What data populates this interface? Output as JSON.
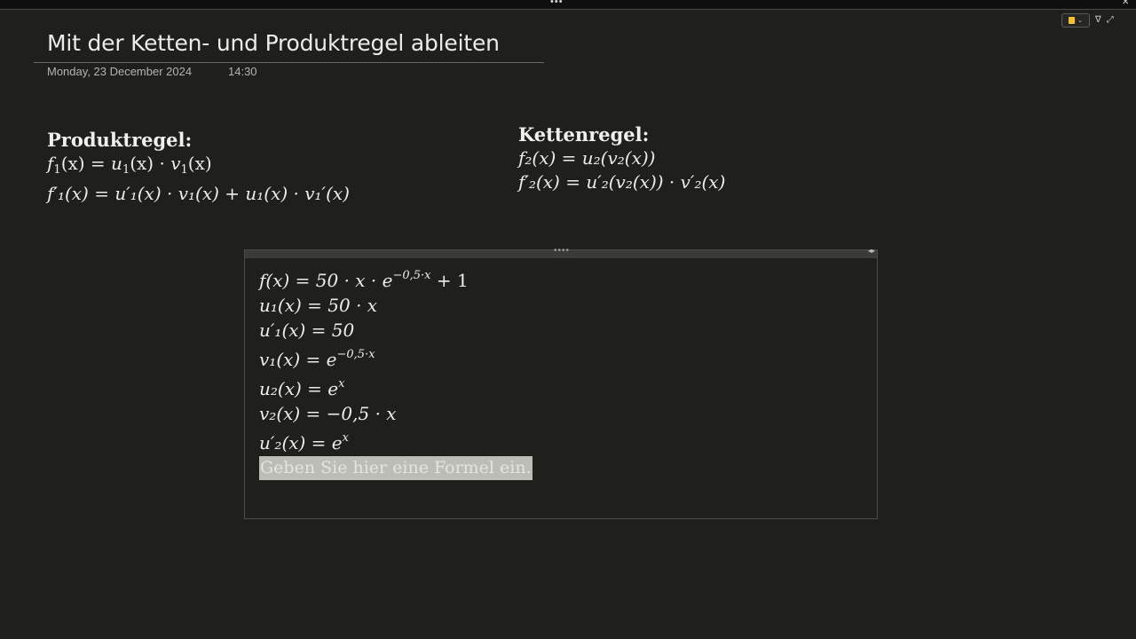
{
  "window": {
    "grip": "•••",
    "close": "✕"
  },
  "toolbar": {
    "caret": "⌄",
    "filter_icon": "∇",
    "expand_icon": "⤢"
  },
  "page": {
    "title": "Mit der Ketten- und Produktregel ableiten",
    "date": "Monday, 23 December 2024",
    "time": "14:30"
  },
  "produktregel": {
    "heading": "Produktregel:",
    "line1": {
      "f": "f",
      "sub1": "1",
      "eq": "(x) = ",
      "u": "u",
      "sub2": "1",
      "mid": "(x) · ",
      "v": "v",
      "sub3": "1",
      "end": "(x)"
    },
    "line2": "f′₁(x) = u′₁(x) · v₁(x) + u₁(x) · v₁′(x)"
  },
  "kettenregel": {
    "heading": "Kettenregel:",
    "line1": "f₂(x) = u₂(v₂(x))",
    "line2": "f′₂(x) = u′₂(v₂(x)) · v′₂(x)"
  },
  "container": {
    "handle": "••••",
    "resize": "◂▸",
    "lines": [
      {
        "base": "f(x) = 50 · x · e",
        "sup": "−0,5·x",
        "tail": " + 1"
      },
      {
        "base": "u₁(x) = 50 · x",
        "sup": "",
        "tail": ""
      },
      {
        "base": "u′₁(x) = 50",
        "sup": "",
        "tail": ""
      },
      {
        "base": "v₁(x) = e",
        "sup": "−0,5·x",
        "tail": ""
      },
      {
        "base": "u₂(x) = e",
        "sup": "x",
        "tail": ""
      },
      {
        "base": "v₂(x) = −0,5 · x",
        "sup": "",
        "tail": ""
      },
      {
        "base": "u′₂(x) = e",
        "sup": "x",
        "tail": ""
      }
    ],
    "placeholder": "Geben Sie hier eine Formel ein."
  }
}
